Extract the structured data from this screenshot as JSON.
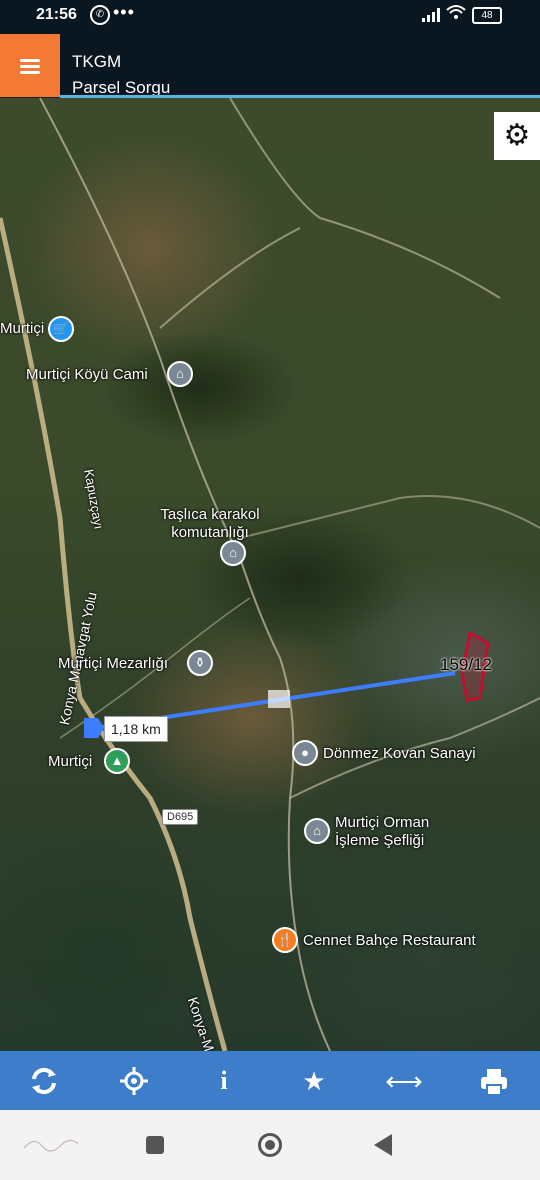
{
  "status_bar": {
    "time": "21:56",
    "battery": "48"
  },
  "header": {
    "title": "TKGM",
    "subtitle": "Parsel Sorgu"
  },
  "map": {
    "labels": {
      "murtici_top": "Murtiçi",
      "cami": "Murtiçi Köyü Cami",
      "karakol": "Taşlıca karakol komutanlığı",
      "kapuz": "Kapuzçayı",
      "konya_yolu": "Konya Manavgat Yolu",
      "mezarlik": "Murtiçi Mezarlığı",
      "murtici_bottom": "Murtiçi",
      "donmez": "Dönmez Kovan Sanayi",
      "orman": "Murtiçi Orman İşleme Şefliği",
      "cennet": "Cennet Bahçe Restaurant",
      "d695": "D695",
      "konya_m": "Konya-M"
    },
    "measurement": "1,18 km",
    "parcel": "159/12"
  },
  "toolbar": {
    "icons": [
      "refresh-icon",
      "locate-icon",
      "info-icon",
      "star-icon",
      "measure-icon",
      "print-icon"
    ]
  },
  "colors": {
    "accent": "#f37934",
    "toolbar": "#3d7dc9",
    "header": "#0b1720"
  }
}
